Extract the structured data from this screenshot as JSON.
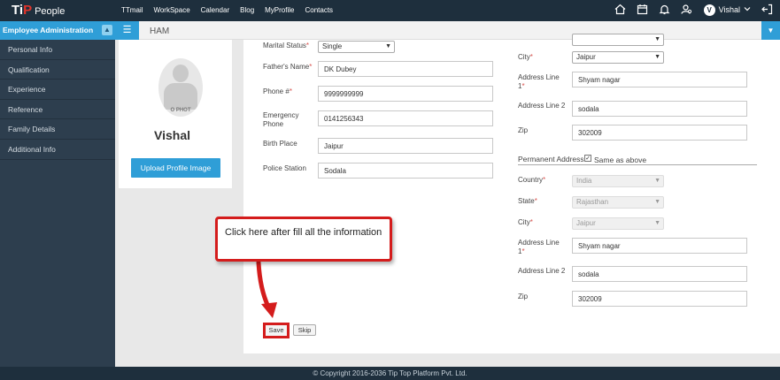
{
  "app": {
    "logo_tip": "Ti",
    "logo_p": "P",
    "logo_people": "People"
  },
  "topnav": [
    "TTmail",
    "WorkSpace",
    "Calendar",
    "Blog",
    "MyProfile",
    "Contacts"
  ],
  "user": {
    "initial": "V",
    "name": "Vishal"
  },
  "sidebar": {
    "header": "Employee Administration",
    "items": [
      "Personal Info",
      "Qualification",
      "Experience",
      "Reference",
      "Family Details",
      "Additional Info"
    ]
  },
  "subheader": {
    "label": "HAM"
  },
  "profile": {
    "name": "Vishal",
    "photo_text": "O PHOT",
    "upload_label": "Upload Profile Image"
  },
  "left_form": {
    "marital_label": "Marital Status",
    "marital_value": "Single",
    "father_label": "Father's Name",
    "father_value": "DK Dubey",
    "phone_label": "Phone #",
    "phone_value": "9999999999",
    "emergency_label_1": "Emergency",
    "emergency_label_2": "Phone",
    "emergency_value": "0141256343",
    "birth_label": "Birth Place",
    "birth_value": "Jaipur",
    "police_label": "Police Station",
    "police_value": "Sodala"
  },
  "current_address": {
    "city_label": "City",
    "city_value": "Jaipur",
    "addr1_label_1": "Address Line",
    "addr1_label_2": "1",
    "addr1_value": "Shyam nagar",
    "addr2_label": "Address Line 2",
    "addr2_value": "sodala",
    "zip_label": "Zip",
    "zip_value": "302009"
  },
  "permanent_address": {
    "title": "Permanent Address",
    "same_as_above": "Same as above",
    "country_label": "Country",
    "country_value": "India",
    "state_label": "State",
    "state_value": "Rajasthan",
    "city_label": "City",
    "city_value": "Jaipur",
    "addr1_label_1": "Address Line",
    "addr1_label_2": "1",
    "addr1_value": "Shyam nagar",
    "addr2_label": "Address Line 2",
    "addr2_value": "sodala",
    "zip_label": "Zip",
    "zip_value": "302009"
  },
  "callout": {
    "text": "Click here after fill all the information"
  },
  "buttons": {
    "save": "Save",
    "skip": "Skip"
  },
  "footer": {
    "text": "© Copyright 2016-2036 Tip Top Platform Pvt. Ltd."
  }
}
